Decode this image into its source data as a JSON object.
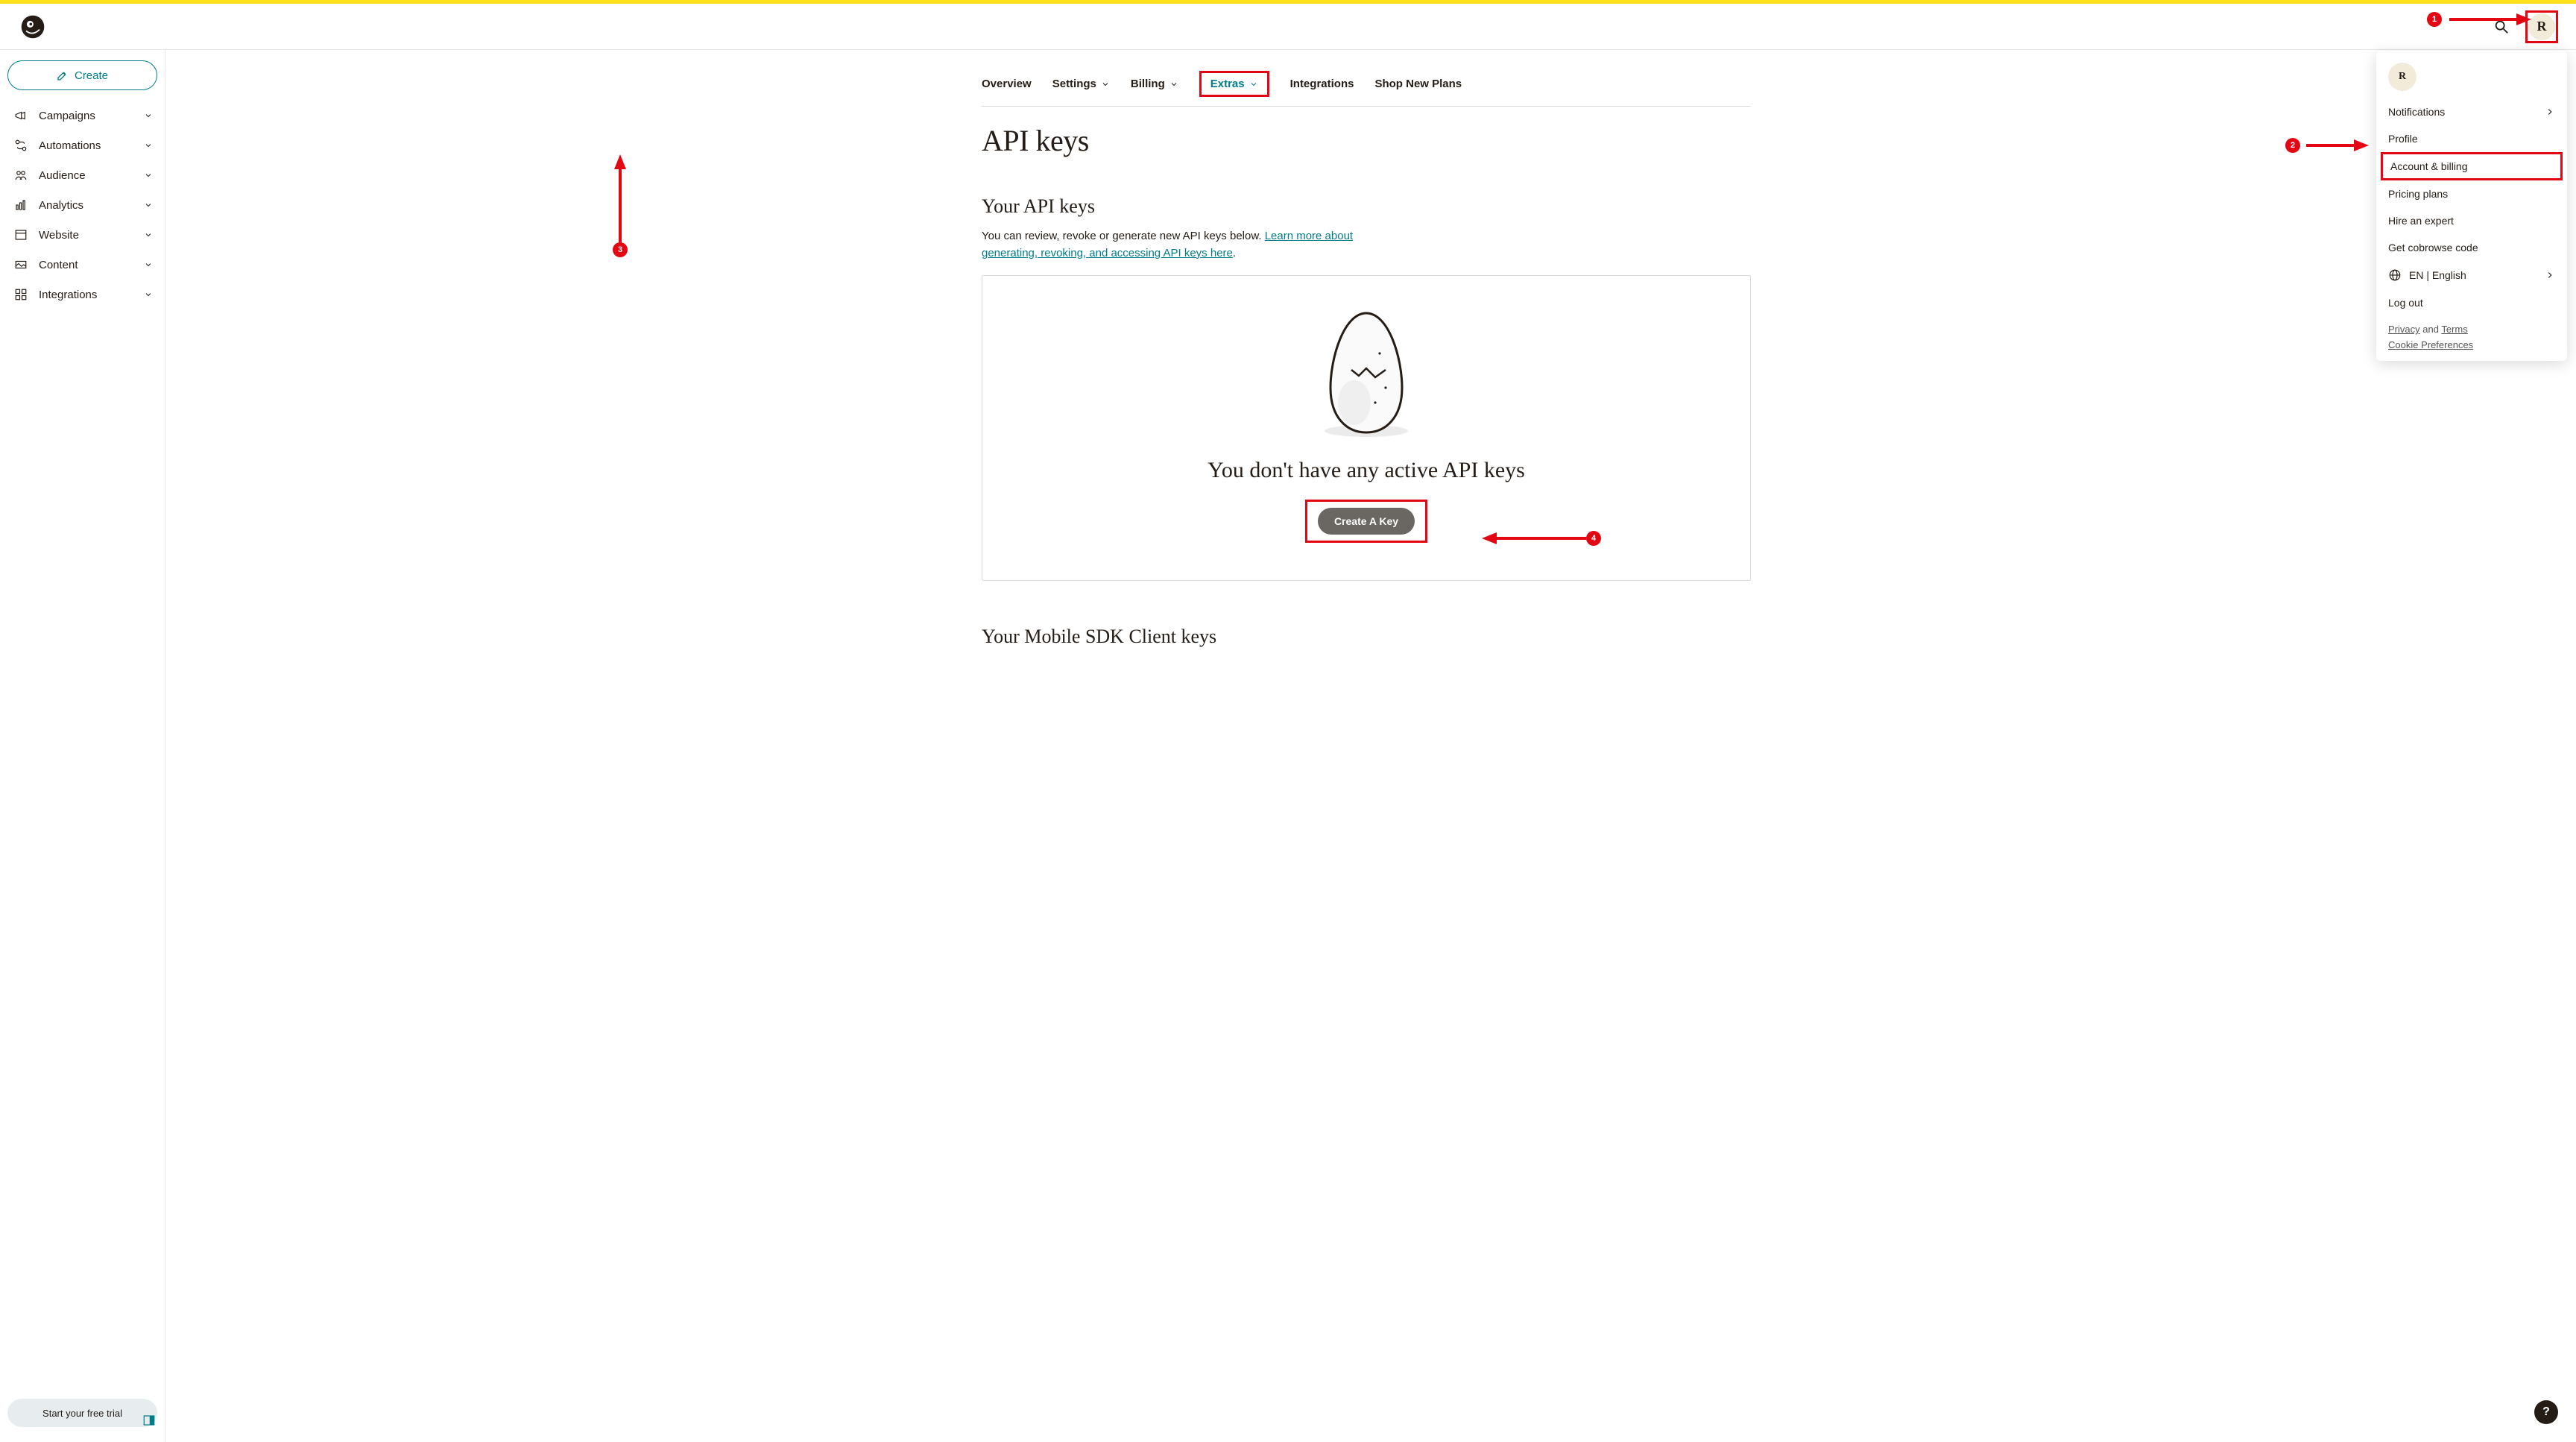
{
  "header": {
    "avatar_initial": "R"
  },
  "sidebar": {
    "create_label": "Create",
    "items": [
      {
        "label": "Campaigns",
        "icon": "megaphone"
      },
      {
        "label": "Automations",
        "icon": "automations"
      },
      {
        "label": "Audience",
        "icon": "audience"
      },
      {
        "label": "Analytics",
        "icon": "analytics"
      },
      {
        "label": "Website",
        "icon": "website"
      },
      {
        "label": "Content",
        "icon": "content"
      },
      {
        "label": "Integrations",
        "icon": "integrations"
      }
    ],
    "trial_label": "Start your free trial"
  },
  "tabs": {
    "overview": "Overview",
    "settings": "Settings",
    "billing": "Billing",
    "extras": "Extras",
    "integrations": "Integrations",
    "shop": "Shop New Plans"
  },
  "page": {
    "title": "API keys",
    "section_api": "Your API keys",
    "desc_pre": "You can review, revoke or generate new API keys below. ",
    "desc_link": "Learn more about generating, revoking, and accessing API keys here",
    "desc_post": ".",
    "empty_heading": "You don't have any active API keys",
    "create_key_label": "Create A Key",
    "section_mobile": "Your Mobile SDK Client keys"
  },
  "dropdown": {
    "avatar_initial": "R",
    "notifications": "Notifications",
    "profile": "Profile",
    "account_billing": "Account & billing",
    "pricing": "Pricing plans",
    "hire": "Hire an expert",
    "cobrowse": "Get cobrowse code",
    "language": "EN | English",
    "logout": "Log out",
    "privacy": "Privacy",
    "and": " and ",
    "terms": "Terms",
    "cookie": "Cookie Preferences"
  },
  "annotations": {
    "b1": "1",
    "b2": "2",
    "b3": "3",
    "b4": "4"
  },
  "help": "?"
}
